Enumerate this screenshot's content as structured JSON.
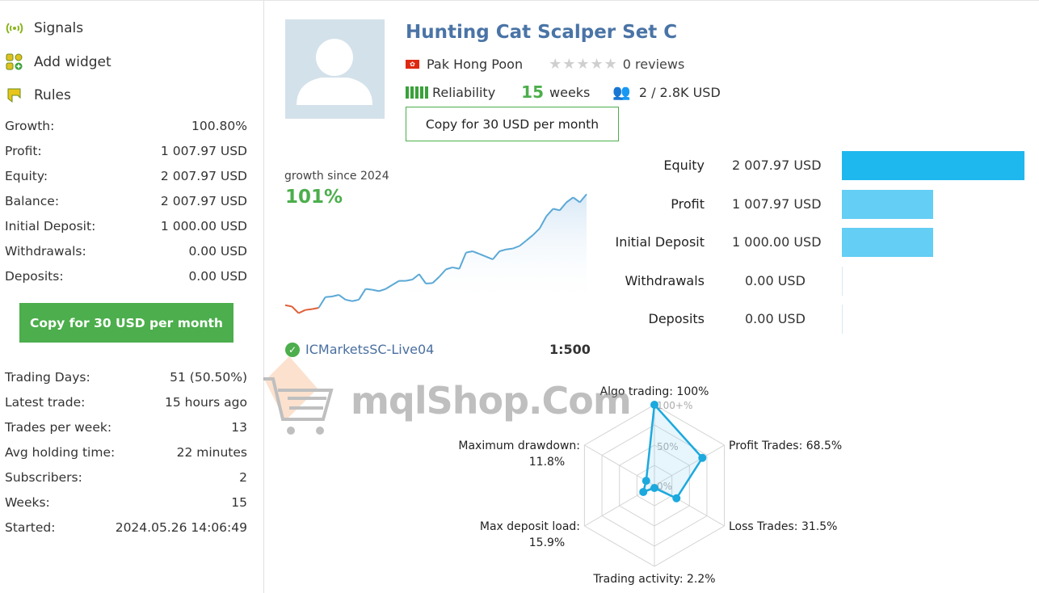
{
  "nav": [
    {
      "label": "Signals",
      "icon": "signal-icon"
    },
    {
      "label": "Add widget",
      "icon": "widget-icon"
    },
    {
      "label": "Rules",
      "icon": "rules-flag-icon"
    }
  ],
  "stats_top": [
    {
      "label": "Growth:",
      "value": "100.80%"
    },
    {
      "label": "Profit:",
      "value": "1 007.97 USD"
    },
    {
      "label": "Equity:",
      "value": "2 007.97 USD"
    },
    {
      "label": "Balance:",
      "value": "2 007.97 USD"
    },
    {
      "label": "Initial Deposit:",
      "value": "1 000.00 USD"
    },
    {
      "label": "Withdrawals:",
      "value": "0.00 USD"
    },
    {
      "label": "Deposits:",
      "value": "0.00 USD"
    }
  ],
  "copy_button": "Copy for 30 USD per month",
  "stats_bottom": [
    {
      "label": "Trading Days:",
      "value": "51 (50.50%)"
    },
    {
      "label": "Latest trade:",
      "value": "15 hours ago"
    },
    {
      "label": "Trades per week:",
      "value": "13"
    },
    {
      "label": "Avg holding time:",
      "value": "22 minutes"
    },
    {
      "label": "Subscribers:",
      "value": "2"
    },
    {
      "label": "Weeks:",
      "value": "15"
    },
    {
      "label": "Started:",
      "value": "2024.05.26 14:06:49"
    }
  ],
  "signal": {
    "title": "Hunting Cat Scalper Set C",
    "author": "Pak Hong Poon",
    "rating": 0,
    "reviews": "0 reviews",
    "reliability": "Reliability",
    "weeks_num": "15",
    "weeks_label": "weeks",
    "subscribers": "2 / 2.8K USD",
    "copy_button": "Copy for 30 USD per month",
    "growth_label": "growth since 2024",
    "growth_value": "101%",
    "server": "ICMarketsSC-Live04",
    "leverage": "1:500"
  },
  "summary_bars": [
    {
      "label": "Equity",
      "value": "2 007.97 USD",
      "amount": 2007.97,
      "color": "#1fb8ee"
    },
    {
      "label": "Profit",
      "value": "1 007.97 USD",
      "amount": 1007.97,
      "color": "#64cef4"
    },
    {
      "label": "Initial Deposit",
      "value": "1 000.00 USD",
      "amount": 1000.0,
      "color": "#64cef4"
    },
    {
      "label": "Withdrawals",
      "value": "0.00 USD",
      "amount": 0,
      "color": "#64cef4"
    },
    {
      "label": "Deposits",
      "value": "0.00 USD",
      "amount": 0,
      "color": "#64cef4"
    }
  ],
  "chart_data": [
    {
      "type": "line",
      "title": "growth since 2024",
      "ylabel": "",
      "xlabel": "",
      "values": [
        0.2,
        -1.0,
        -7.1,
        -4.2,
        -3.4,
        -2.2,
        7.6,
        8.1,
        9.6,
        5.2,
        3.9,
        5.2,
        15.0,
        14.3,
        13.0,
        15.0,
        18.7,
        22.4,
        22.4,
        23.6,
        28.5,
        19.9,
        20.4,
        26.1,
        32.9,
        34.7,
        33.4,
        48.2,
        49.4,
        47.0,
        44.5,
        42.0,
        49.4,
        51.1,
        51.9,
        54.3,
        59.2,
        64.2,
        70.3,
        81.4,
        88.2,
        86.8,
        94.1,
        98.6,
        94.1,
        101.5
      ],
      "colors": {
        "positive": "#5aa8d6",
        "negative": "#e0603a"
      }
    },
    {
      "type": "radar",
      "ring_labels": [
        "0%",
        "50%",
        "100+%"
      ],
      "axes": [
        {
          "label": "Algo trading: 100%",
          "value": 100
        },
        {
          "label": "Profit Trades: 68.5%",
          "value": 68.5
        },
        {
          "label": "Loss Trades: 31.5%",
          "value": 31.5
        },
        {
          "label": "Trading activity: 2.2%",
          "value": 2.2
        },
        {
          "label": "Max deposit load:",
          "sub": "15.9%",
          "value": 15.9
        },
        {
          "label": "Maximum drawdown:",
          "sub": "11.8%",
          "value": 11.8
        }
      ],
      "color": "#1ba9de"
    }
  ],
  "watermark": "mqlShop.Com"
}
